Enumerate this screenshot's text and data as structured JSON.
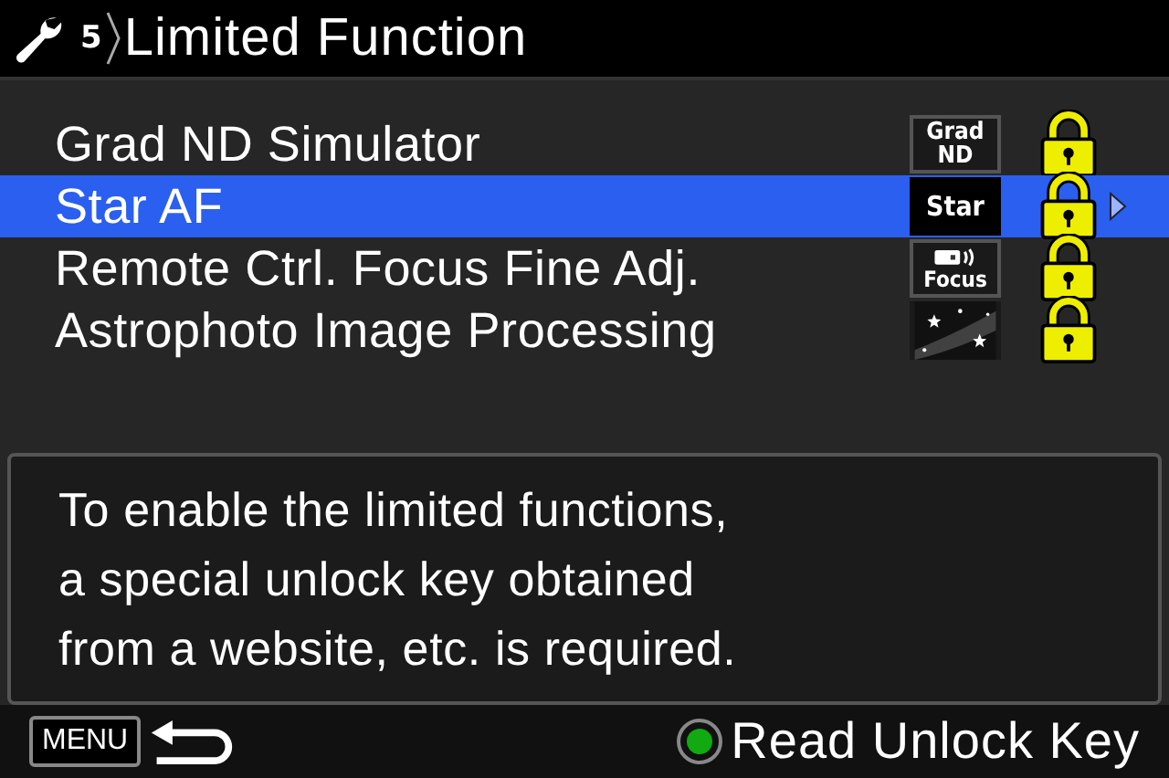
{
  "header": {
    "section_number": "5",
    "title": "Limited Function"
  },
  "items": [
    {
      "label": "Grad ND Simulator",
      "kind": "text-badge",
      "badge": "Grad\nND",
      "locked": true,
      "selected": false
    },
    {
      "label": "Star AF",
      "kind": "text-badge",
      "badge": "Star",
      "locked": true,
      "selected": true
    },
    {
      "label": "Remote Ctrl. Focus Fine Adj.",
      "kind": "remote-badge",
      "badge": "Focus",
      "locked": true,
      "selected": false
    },
    {
      "label": "Astrophoto Image Processing",
      "kind": "sky-badge",
      "locked": true,
      "selected": false
    }
  ],
  "description": "To enable the limited functions,\na special unlock key obtained\nfrom a website, etc. is required.",
  "footer": {
    "menu_key": "MENU",
    "ok_label": "Read Unlock Key"
  }
}
